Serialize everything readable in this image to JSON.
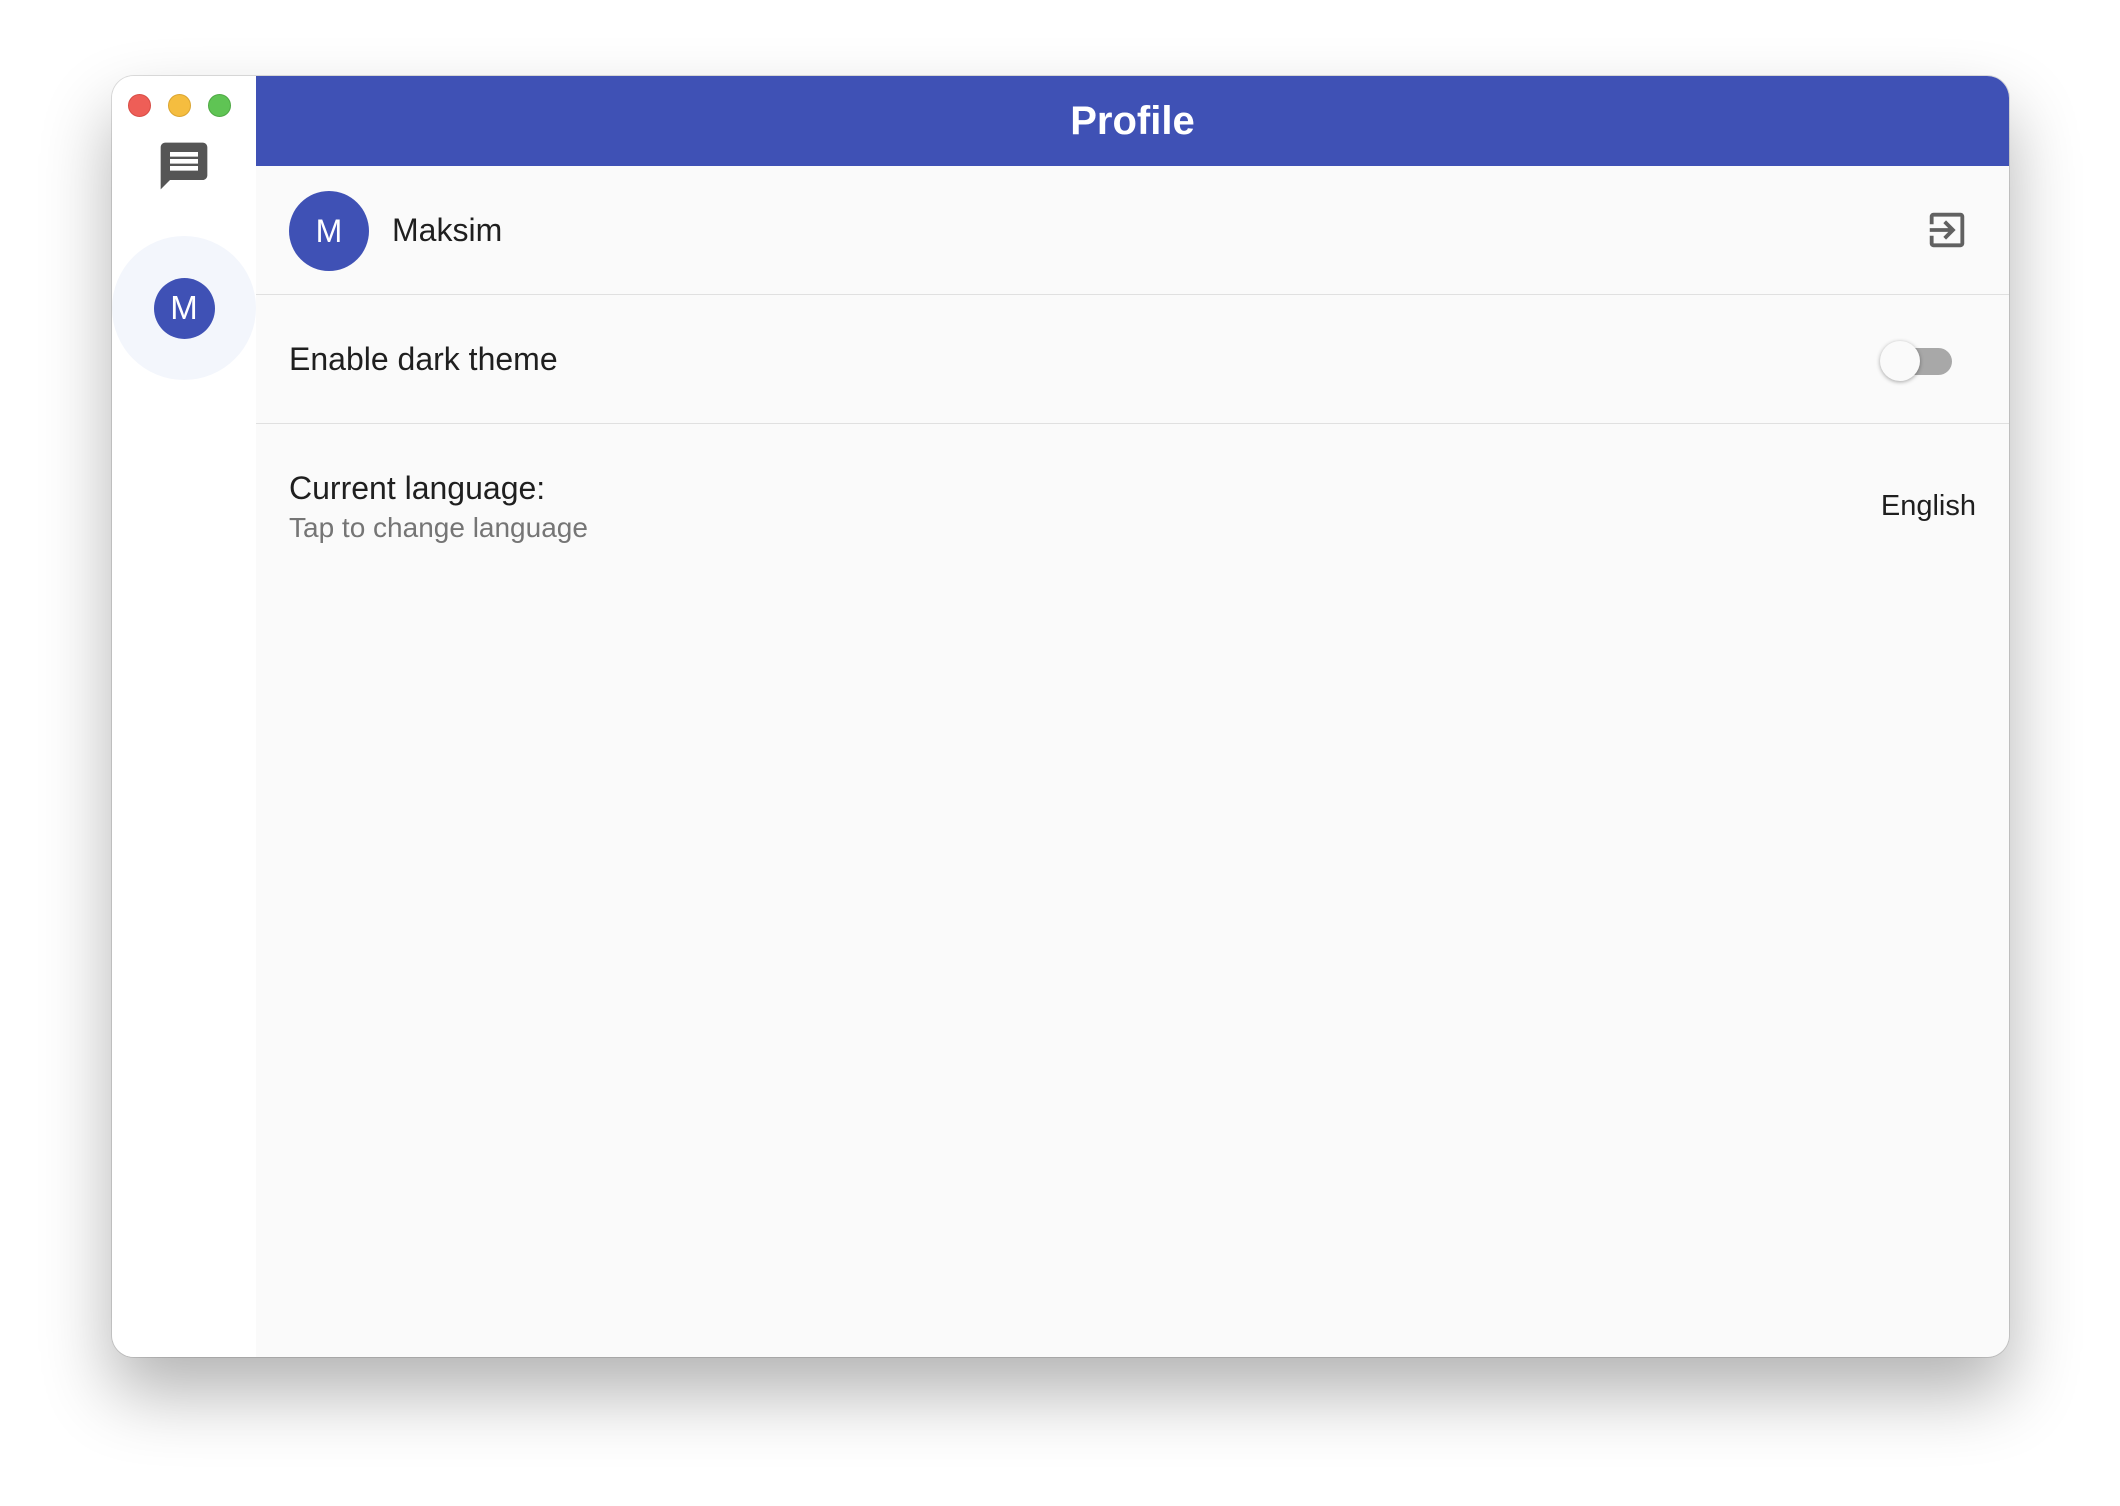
{
  "window": {
    "controls": [
      "close",
      "minimize",
      "maximize"
    ]
  },
  "rail": {
    "chats_icon": "chat-bubble-icon",
    "profile_avatar_initial": "M"
  },
  "appbar": {
    "title": "Profile"
  },
  "profile": {
    "avatar_initial": "M",
    "name": "Maksim",
    "logout_icon": "logout-icon"
  },
  "settings": {
    "dark_theme_label": "Enable dark theme",
    "dark_theme_enabled": false,
    "language_title": "Current language:",
    "language_subtitle": "Tap to change language",
    "language_value": "English"
  },
  "colors": {
    "primary": "#3f51b5",
    "background": "#fafafa",
    "rail_background": "#ffffff",
    "divider": "#e0e0e0"
  }
}
